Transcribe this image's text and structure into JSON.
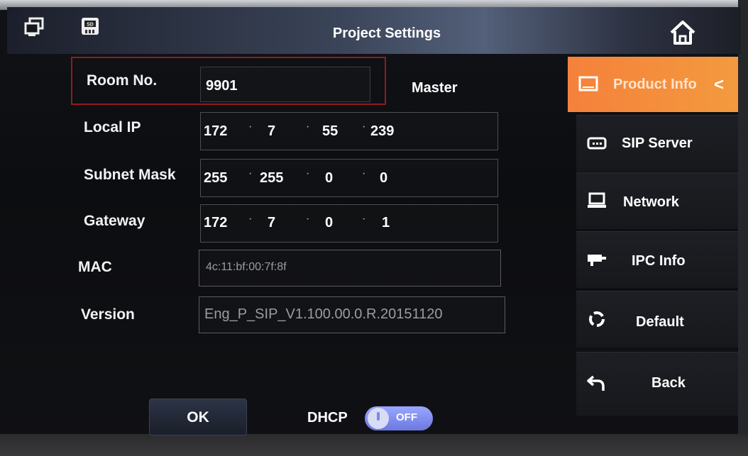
{
  "header": {
    "title": "Project Settings",
    "left_icons": [
      "monitor-copy-icon",
      "sd-card-icon"
    ],
    "home_icon": "home-icon"
  },
  "form": {
    "room_no": {
      "label": "Room No.",
      "value": "9901",
      "role": "Master"
    },
    "local_ip": {
      "label": "Local IP",
      "octets": [
        "172",
        "7",
        "55",
        "239"
      ]
    },
    "subnet_mask": {
      "label": "Subnet Mask",
      "octets": [
        "255",
        "255",
        "0",
        "0"
      ]
    },
    "gateway": {
      "label": "Gateway",
      "octets": [
        "172",
        "7",
        "0",
        "1"
      ]
    },
    "mac": {
      "label": "MAC",
      "value": "4c:11:bf:00:7f:8f"
    },
    "version": {
      "label": "Version",
      "value": "Eng_P_SIP_V1.100.00.0.R.20151120"
    },
    "ok_label": "OK",
    "dhcp": {
      "label": "DHCP",
      "state": "OFF"
    }
  },
  "nav": {
    "items": [
      {
        "label": "Product Info",
        "icon": "product-info-icon",
        "active": true
      },
      {
        "label": "SIP Server",
        "icon": "sip-server-icon",
        "active": false
      },
      {
        "label": "Network",
        "icon": "network-icon",
        "active": false
      },
      {
        "label": "IPC Info",
        "icon": "camera-icon",
        "active": false
      },
      {
        "label": "Default",
        "icon": "recycle-icon",
        "active": false
      },
      {
        "label": "Back",
        "icon": "back-arrow-icon",
        "active": false
      }
    ],
    "active_color": "#f5813b"
  }
}
